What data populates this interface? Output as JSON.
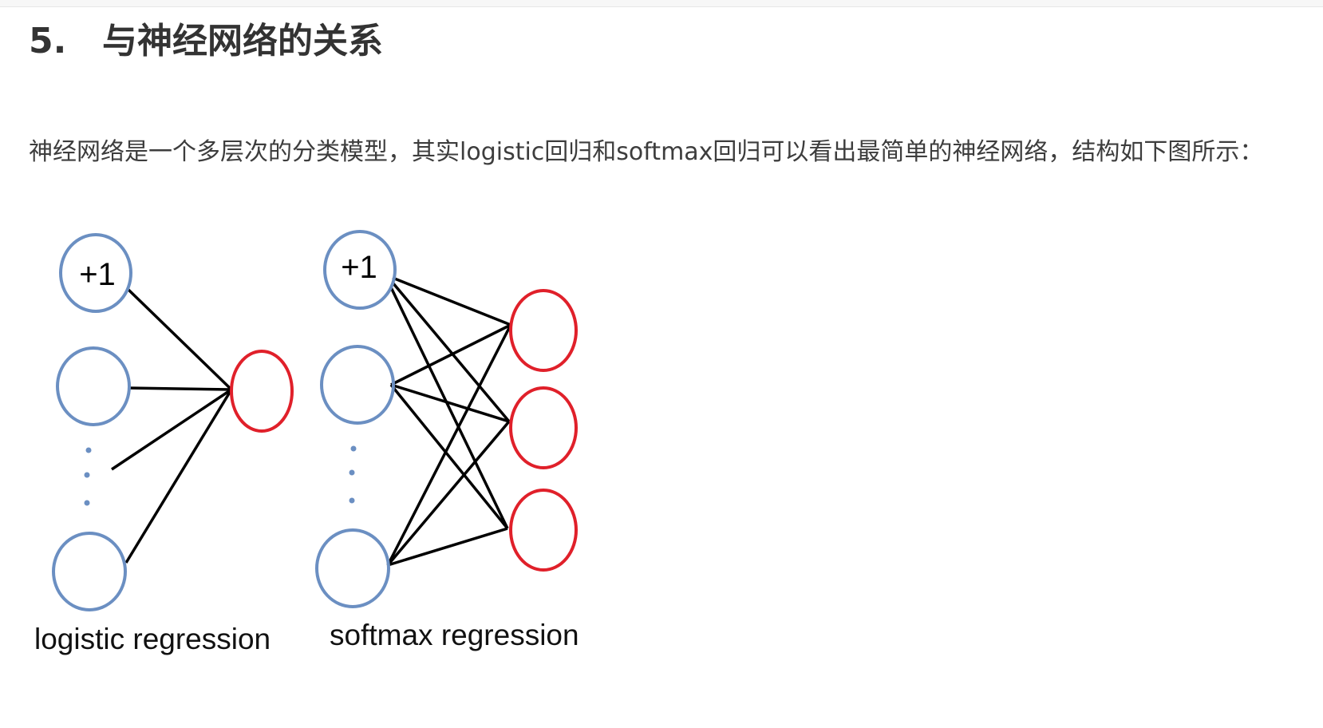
{
  "section": {
    "number": "5.",
    "title": "与神经网络的关系"
  },
  "paragraph": {
    "text": "神经网络是一个多层次的分类模型，其实logistic回归和softmax回归可以看出最简单的神经网络，结构如下图所示："
  },
  "figure": {
    "colors": {
      "input_node": "#6b8fc2",
      "output_node": "#e0202a",
      "edge": "#000000",
      "dot": "#6b8fc2"
    },
    "logistic": {
      "bias_label": "+1",
      "caption": "logistic regression"
    },
    "softmax": {
      "bias_label": "+1",
      "caption": "softmax regression"
    }
  }
}
